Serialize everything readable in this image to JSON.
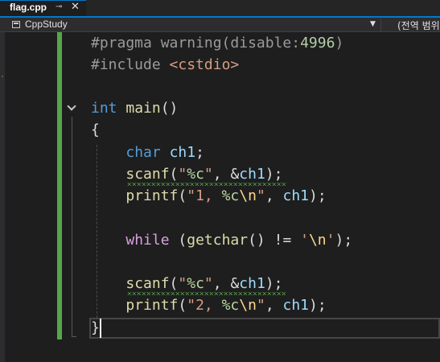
{
  "tab": {
    "title": "flag.cpp",
    "pin_icon": "pin-icon",
    "close_icon": "close-icon"
  },
  "navbar": {
    "project": "CppStudy",
    "scope": "(전역 범위"
  },
  "colors": {
    "accent": "#007acc",
    "change_bar": "#57a64a",
    "keyword": "#569cd6",
    "function": "#dcdcaa",
    "string": "#d69d85",
    "variable": "#9cdcfe"
  },
  "code": {
    "pragma": {
      "directive": "#pragma warning(disable:",
      "number": "4996",
      "close": ")"
    },
    "include": {
      "directive": "#include ",
      "header": "<cstdio>"
    },
    "main_sig": {
      "type": "int",
      "name": "main",
      "parens": "()"
    },
    "open_brace": "{",
    "decl": {
      "type": "char",
      "name": "ch1",
      "end": ";"
    },
    "scanf1": {
      "fn": "scanf",
      "open": "(",
      "q1": "\"",
      "fmt": "%c",
      "q2": "\"",
      "mid": ", &",
      "arg": "ch1",
      "end": ");"
    },
    "printf1": {
      "fn": "printf",
      "open": "(",
      "s1": "\"1, ",
      "fmt": "%c",
      "esc": "\\n",
      "s2": "\"",
      "mid": ", ",
      "arg": "ch1",
      "end": ");"
    },
    "while_line": {
      "kw": "while",
      "p1": " (",
      "fn": "getchar",
      "p2": "() != ",
      "c1": "'",
      "esc": "\\n",
      "c2": "'",
      "end": ");"
    },
    "scanf2": {
      "fn": "scanf",
      "open": "(",
      "q1": "\"",
      "fmt": "%c",
      "q2": "\"",
      "mid": ", &",
      "arg": "ch1",
      "end": ");"
    },
    "printf2": {
      "fn": "printf",
      "open": "(",
      "s1": "\"2, ",
      "fmt": "%c",
      "esc": "\\n",
      "s2": "\"",
      "mid": ", ",
      "arg": "ch1",
      "end": ");"
    },
    "close_brace": "}"
  }
}
